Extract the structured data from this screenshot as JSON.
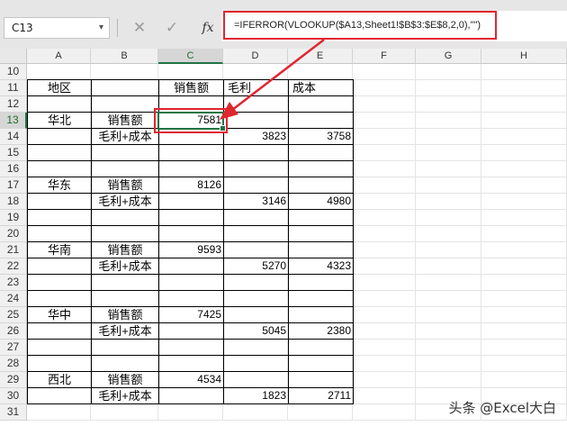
{
  "formula_bar": {
    "name_box": "C13",
    "cancel_icon": "✕",
    "enter_icon": "✓",
    "fx_label": "fx",
    "formula": "=IFERROR(VLOOKUP($A13,Sheet1!$B$3:$E$8,2,0),\"\")"
  },
  "columns": [
    "A",
    "B",
    "C",
    "D",
    "E",
    "F",
    "G",
    "H"
  ],
  "rows": [
    "10",
    "11",
    "12",
    "13",
    "14",
    "15",
    "16",
    "17",
    "18",
    "19",
    "20",
    "21",
    "22",
    "23",
    "24",
    "25",
    "26",
    "27",
    "28",
    "29",
    "30",
    "31"
  ],
  "selected": {
    "column": "C",
    "row": "13"
  },
  "table": {
    "header": {
      "region": "地区",
      "sales": "销售额",
      "gross": "毛利",
      "cost": "成本"
    },
    "sales_label": "销售额",
    "profit_cost_label": "毛利+成本",
    "groups": [
      {
        "region": "华北",
        "sales": "7581",
        "gross": "3823",
        "cost": "3758"
      },
      {
        "region": "华东",
        "sales": "8126",
        "gross": "3146",
        "cost": "4980"
      },
      {
        "region": "华南",
        "sales": "9593",
        "gross": "5270",
        "cost": "4323"
      },
      {
        "region": "华中",
        "sales": "7425",
        "gross": "5045",
        "cost": "2380"
      },
      {
        "region": "西北",
        "sales": "4534",
        "gross": "1823",
        "cost": "2711"
      }
    ]
  },
  "watermark": "头条 @Excel大白",
  "colors": {
    "accent_green": "#217346",
    "highlight_red": "#e0262f"
  }
}
